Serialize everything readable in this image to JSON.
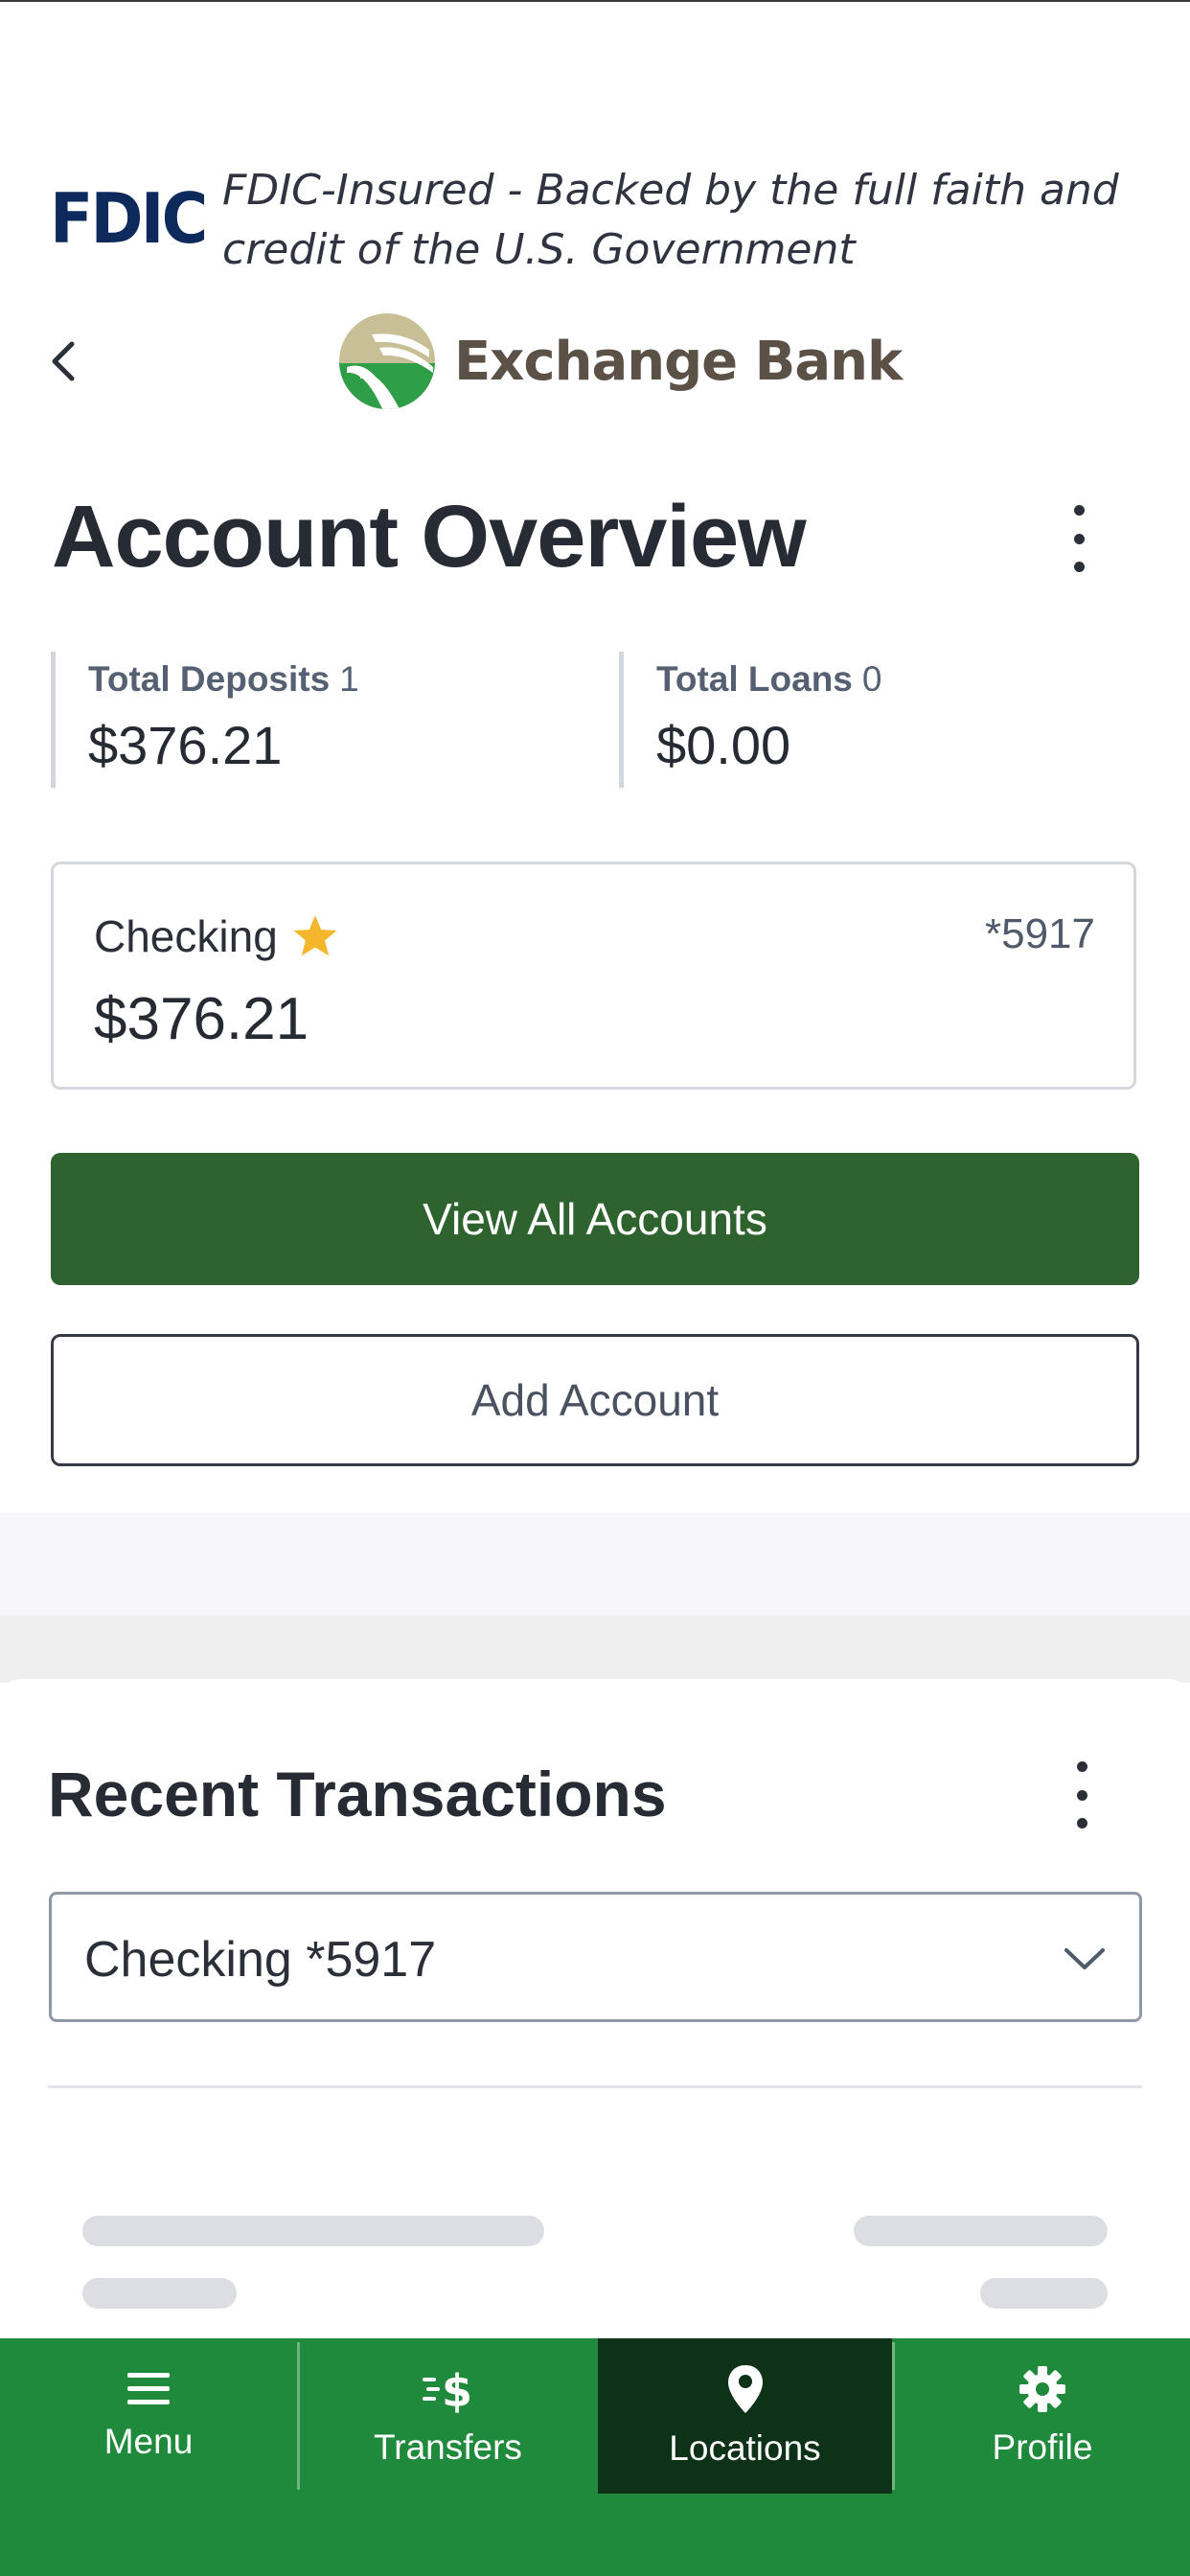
{
  "fdic": {
    "logo": "FDIC",
    "text": "FDIC-Insured - Backed by the full faith and credit of the U.S. Government"
  },
  "header": {
    "brand_name": "Exchange Bank"
  },
  "overview": {
    "title": "Account Overview",
    "total_deposits_label": "Total Deposits",
    "total_deposits_count": "1",
    "total_deposits_value": "$376.21",
    "total_loans_label": "Total Loans",
    "total_loans_count": "0",
    "total_loans_value": "$0.00"
  },
  "account": {
    "name": "Checking",
    "number": "*5917",
    "balance": "$376.21",
    "favorite_color": "#f4b72c"
  },
  "buttons": {
    "view_all": "View All Accounts",
    "add_account": "Add Account"
  },
  "transactions": {
    "title": "Recent Transactions",
    "selected_account": "Checking *5917"
  },
  "nav": {
    "items": [
      {
        "label": "Menu",
        "icon": "menu-icon"
      },
      {
        "label": "Transfers",
        "icon": "transfers-icon"
      },
      {
        "label": "Locations",
        "icon": "location-pin-icon",
        "active": true
      },
      {
        "label": "Profile",
        "icon": "gear-icon"
      }
    ]
  },
  "colors": {
    "primary_green": "#2e6330",
    "nav_green": "#1f8a3c",
    "nav_active": "#0e3217",
    "fdic_navy": "#0e2a5c"
  }
}
